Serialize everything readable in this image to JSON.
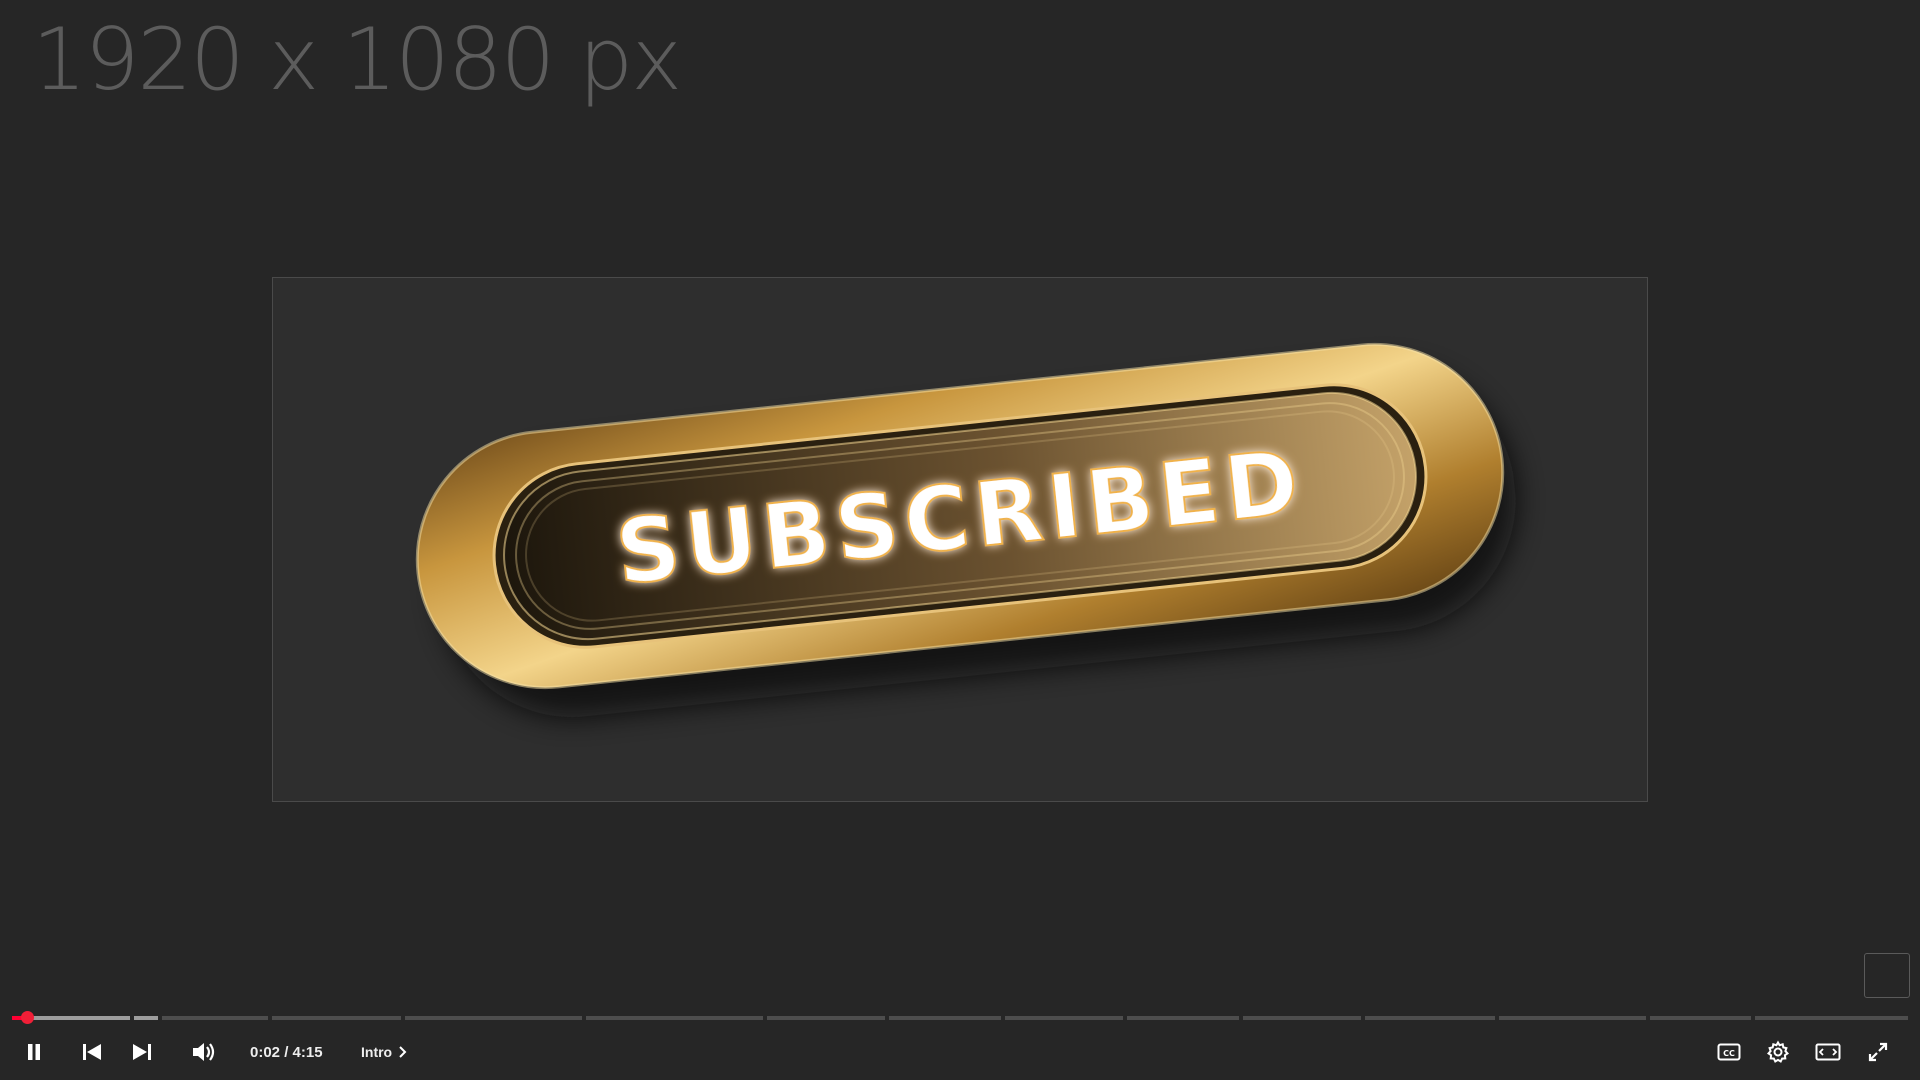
{
  "watermark": {
    "text": "1920 x 1080 px"
  },
  "video": {
    "badge_text": "SUBSCRIBED",
    "colors": {
      "gold": "#c8963e",
      "gold_light": "#f3d48a",
      "badge_text": "#ffffff"
    }
  },
  "progress": {
    "played_fraction": 0.008,
    "buffered_fraction": 0.078,
    "chapter_count": 14,
    "color_played": "#ff0033"
  },
  "controls": {
    "time_display": "0:02 / 4:15",
    "current_chapter": "Intro",
    "icons": {
      "play_pause": "pause-icon",
      "previous": "previous-icon",
      "next": "next-icon",
      "volume": "volume-icon",
      "chapter_chevron": "chevron-right-icon",
      "captions": "captions-icon",
      "settings": "gear-icon",
      "theater": "theater-mode-icon",
      "fullscreen": "fullscreen-icon"
    }
  }
}
